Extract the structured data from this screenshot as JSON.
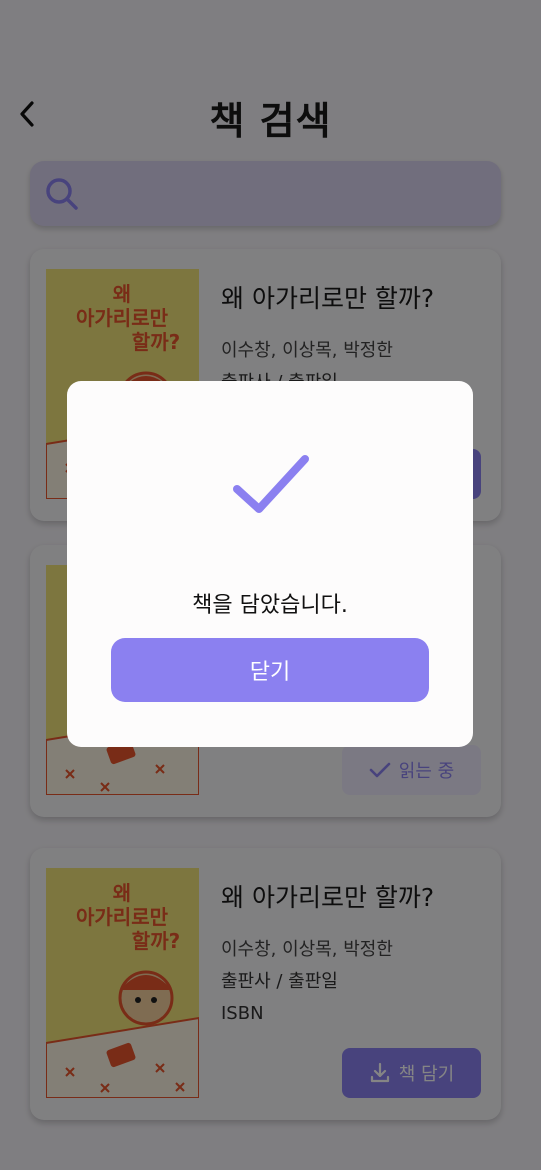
{
  "header": {
    "title": "책 검색",
    "back_icon": "chevron-left-icon"
  },
  "search": {
    "icon": "search-icon",
    "value": "",
    "placeholder": ""
  },
  "colors": {
    "accent": "#8b80f0",
    "accent_light": "#ebe9fb",
    "search_bg": "#d9d4ef",
    "cover_yellow": "#f0e27a",
    "cover_orange": "#e8552d",
    "overlay": "rgba(0,0,0,0.48)"
  },
  "books": [
    {
      "title": "왜 아가리로만 할까?",
      "authors": "이수창,  이상목, 박정한",
      "publisher": "출판사 / 출판일",
      "isbn": "",
      "cover_title_line1": "왜",
      "cover_title_line2": "아가리로만",
      "cover_title_line3": "할까?",
      "button_label": "",
      "button_icon": ""
    },
    {
      "title": "",
      "authors": "",
      "publisher": "",
      "isbn": "",
      "cover_title_line1": "",
      "cover_title_line2": "",
      "cover_title_line3": "",
      "button_label": "읽는 중",
      "button_icon": "check-icon"
    },
    {
      "title": "왜 아가리로만 할까?",
      "authors": "이수창,  이상목, 박정한",
      "publisher": "출판사 / 출판일",
      "isbn": "ISBN",
      "cover_title_line1": "왜",
      "cover_title_line2": "아가리로만",
      "cover_title_line3": "할까?",
      "button_label": "책 담기",
      "button_icon": "download-icon"
    }
  ],
  "modal": {
    "icon": "checkmark-icon",
    "message": "책을 담았습니다.",
    "close_label": "닫기"
  }
}
